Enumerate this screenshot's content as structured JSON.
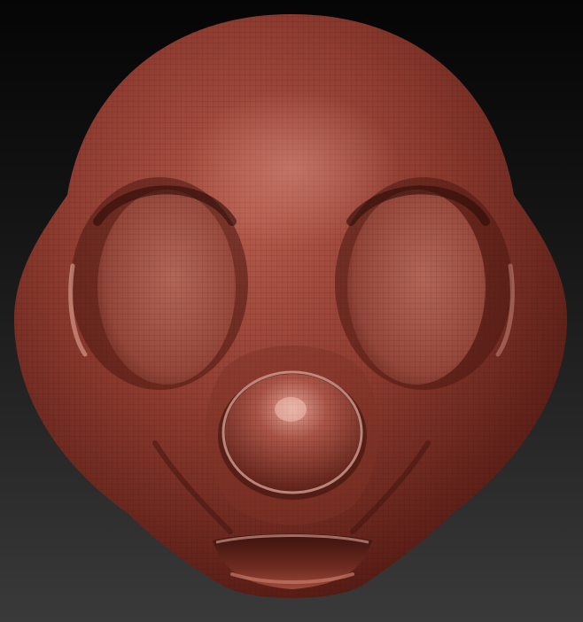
{
  "scene": {
    "subject": "sculpted-head-model",
    "background_top": "#050505",
    "background_bottom": "#3a3a3a",
    "material_base": "#8c3a2e",
    "material_highlight": "#d98f80",
    "material_shadow": "#3d140e",
    "wireframe_visible": true
  }
}
